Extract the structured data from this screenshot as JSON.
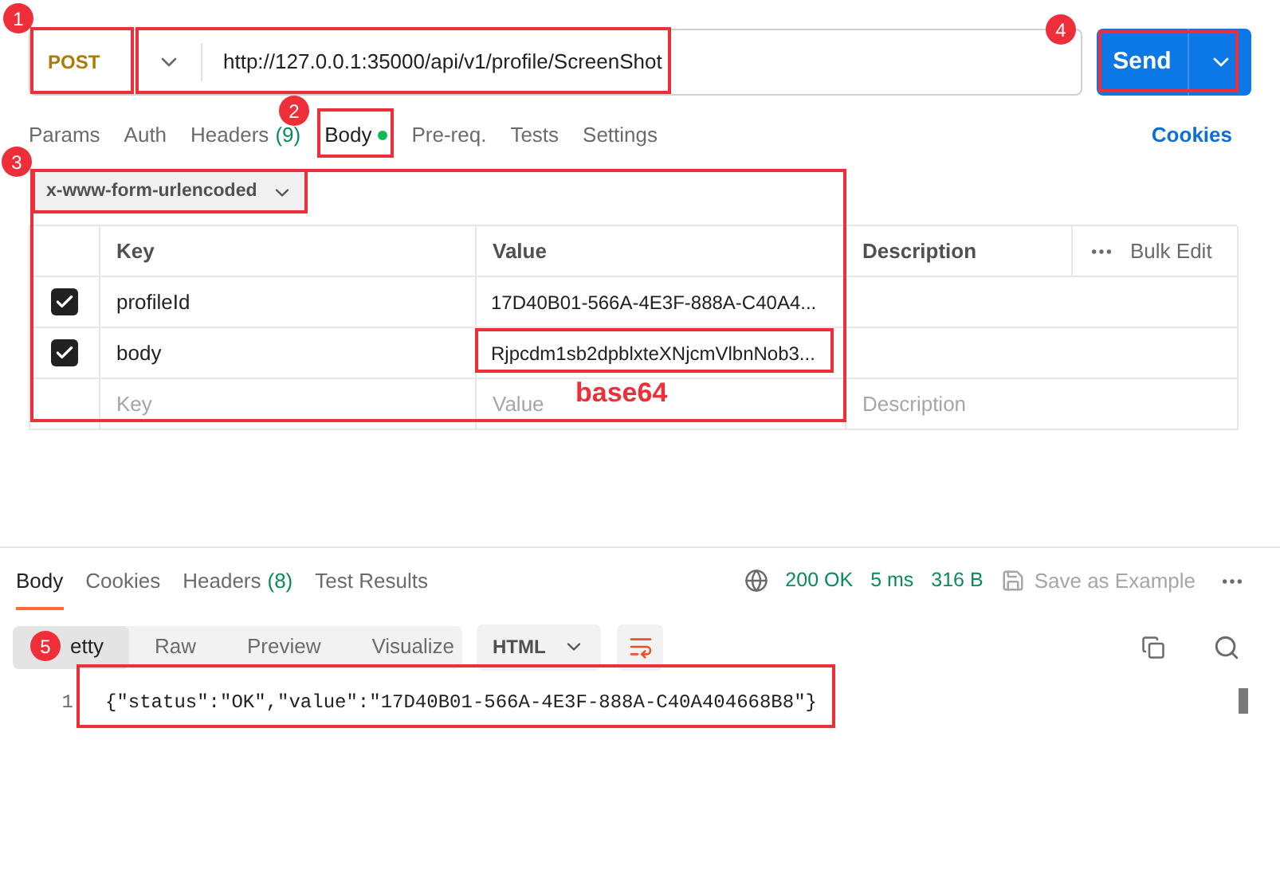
{
  "request": {
    "method": "POST",
    "url": "http://127.0.0.1:35000/api/v1/profile/ScreenShot",
    "send": "Send"
  },
  "request_tabs": [
    {
      "label": "Params",
      "selected": false,
      "dot": false
    },
    {
      "label": "Auth",
      "selected": false,
      "dot": false
    },
    {
      "label": "Headers",
      "count": "(9)",
      "selected": false,
      "dot": false
    },
    {
      "label": "Body",
      "selected": true,
      "dot": true
    },
    {
      "label": "Pre-req.",
      "selected": false,
      "dot": false
    },
    {
      "label": "Tests",
      "selected": false,
      "dot": false
    },
    {
      "label": "Settings",
      "selected": false,
      "dot": false
    }
  ],
  "cookies_link": "Cookies",
  "body_type": "x-www-form-urlencoded",
  "params_table": {
    "columns": [
      "Key",
      "Value",
      "Description"
    ],
    "bulk_edit": "Bulk Edit",
    "rows": [
      {
        "checked": true,
        "key": "profileId",
        "value": "17D40B01-566A-4E3F-888A-C40A4..."
      },
      {
        "checked": true,
        "key": "body",
        "value": "Rjpcdm1sb2dpblxteXNjcmVlbnNob3..."
      }
    ],
    "new_row": {
      "key": {
        "placeholder": "Key"
      },
      "value": {
        "placeholder": "Value"
      },
      "description": {
        "placeholder": "Description"
      }
    }
  },
  "response": {
    "tabs": [
      {
        "label": "Body",
        "selected": true
      },
      {
        "label": "Cookies",
        "selected": false
      },
      {
        "label": "Headers",
        "count": "(8)",
        "selected": false
      },
      {
        "label": "Test Results",
        "selected": false
      }
    ],
    "status": "200 OK",
    "time": "5 ms",
    "size": "316 B",
    "save": "Save as Example",
    "format_tabs": [
      {
        "label": "etty",
        "selected": true
      },
      {
        "label": "Raw",
        "selected": false
      },
      {
        "label": "Preview",
        "selected": false
      },
      {
        "label": "Visualize",
        "selected": false
      }
    ],
    "format": "HTML",
    "code_lines": [
      {
        "number": "1",
        "text": "{\"status\":\"OK\",\"value\":\"17D40B01-566A-4E3F-888A-C40A404668B8\"}"
      }
    ]
  },
  "annotations": {
    "badges": [
      "1",
      "2",
      "3",
      "4",
      "5"
    ],
    "note": "base64"
  }
}
